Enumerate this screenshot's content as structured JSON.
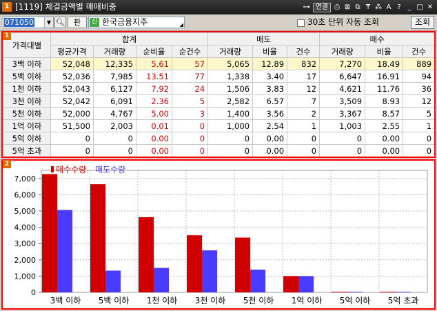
{
  "window": {
    "number": "1",
    "title": "[1119] 체결금액별 매매비중",
    "icons": [
      "pin-icon",
      "link-icon",
      "print-icon",
      "window-icon",
      "transfer-icon",
      "setting-icon",
      "font-icon",
      "help-icon",
      "minimize-icon",
      "maximize-icon",
      "close-icon"
    ],
    "link_label": "연결"
  },
  "toolbar": {
    "code": "071050",
    "pan_label": "판",
    "sin_label": "신",
    "stock_name": "한국금융지주",
    "auto_label": "30초 단위 자동 조회",
    "auto_checked": false,
    "query_label": "조회"
  },
  "panels": {
    "table_tag": "1",
    "chart_tag": "2"
  },
  "table": {
    "row_header": "가격대별",
    "groups": [
      "합계",
      "매도",
      "매수"
    ],
    "columns": [
      "평균가격",
      "거래량",
      "순비율",
      "순건수",
      "거래량",
      "비율",
      "건수",
      "거래량",
      "비율",
      "건수"
    ],
    "rows": [
      {
        "label": "3백 이하",
        "cells": [
          "52,048",
          "12,335",
          "5.61",
          "57",
          "5,065",
          "12.89",
          "832",
          "7,270",
          "18.49",
          "889"
        ]
      },
      {
        "label": "5백 이하",
        "cells": [
          "52,036",
          "7,985",
          "13.51",
          "77",
          "1,338",
          "3.40",
          "17",
          "6,647",
          "16.91",
          "94"
        ]
      },
      {
        "label": "1천 이하",
        "cells": [
          "52,043",
          "6,127",
          "7.92",
          "24",
          "1,506",
          "3.83",
          "12",
          "4,621",
          "11.76",
          "36"
        ]
      },
      {
        "label": "3천 이하",
        "cells": [
          "52,042",
          "6,091",
          "2.36",
          "5",
          "2,582",
          "6.57",
          "7",
          "3,509",
          "8.93",
          "12"
        ]
      },
      {
        "label": "5천 이하",
        "cells": [
          "52,000",
          "4,767",
          "5.00",
          "3",
          "1,400",
          "3.56",
          "2",
          "3,367",
          "8.57",
          "5"
        ]
      },
      {
        "label": "1억 이하",
        "cells": [
          "51,500",
          "2,003",
          "0.01",
          "0",
          "1,000",
          "2.54",
          "1",
          "1,003",
          "2.55",
          "1"
        ]
      },
      {
        "label": "5억 이하",
        "cells": [
          "0",
          "0",
          "0.00",
          "0",
          "0",
          "0.00",
          "0",
          "0",
          "0.00",
          "0"
        ]
      },
      {
        "label": "5억 초과",
        "cells": [
          "0",
          "0",
          "0.00",
          "0",
          "0",
          "0.00",
          "0",
          "0",
          "0.00",
          "0"
        ]
      }
    ],
    "highlight_row": 0,
    "colors": {
      "red": "#d40000",
      "highlight": "#fff7cc"
    }
  },
  "chart_data": {
    "type": "bar",
    "categories": [
      "3백 이하",
      "5백 이하",
      "1천 이하",
      "3천 이하",
      "5천 이하",
      "1억 이하",
      "5억 이하",
      "5억 초과"
    ],
    "series": [
      {
        "name": "매수수량",
        "color": "#d00000",
        "values": [
          7270,
          6647,
          4621,
          3509,
          3367,
          1003,
          0,
          0
        ]
      },
      {
        "name": "매도수량",
        "color": "#4a3cff",
        "values": [
          5065,
          1338,
          1506,
          2582,
          1400,
          1000,
          0,
          0
        ]
      }
    ],
    "title": "",
    "xlabel": "",
    "ylabel": "",
    "ylim": [
      0,
      7500
    ],
    "yticks": [
      0,
      1000,
      2000,
      3000,
      4000,
      5000,
      6000,
      7000
    ],
    "ytick_labels": [
      "0",
      "1,000",
      "2,000",
      "3,000",
      "4,000",
      "5,000",
      "6,000",
      "7,000"
    ],
    "grid": true,
    "legend": "top-left"
  }
}
